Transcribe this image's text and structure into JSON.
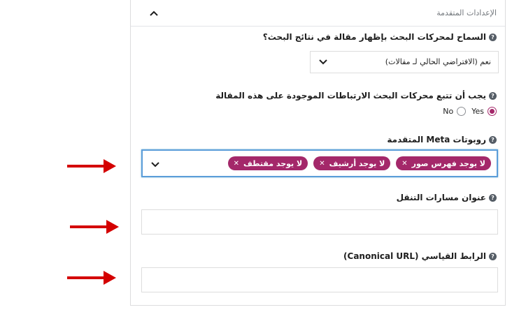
{
  "section": {
    "title": "الإعدادات المتقدمة"
  },
  "allow_search": {
    "label": "السماح لمحركات البحث بإظهار مقالة في نتائج البحث؟",
    "selected": "نعم (الافتراضي الحالي لـ مقالات)"
  },
  "follow_links": {
    "label": "يجب أن تتبع محركات البحث الارتباطات الموجودة على هذه المقالة",
    "yes_label": "Yes",
    "no_label": "No",
    "value": "Yes"
  },
  "meta_robots": {
    "label": "روبوتات Meta المتقدمة",
    "tags": [
      "لا يوجد فهرس صور",
      "لا يوجد أرشيف",
      "لا يوجد مقتطف"
    ]
  },
  "breadcrumbs": {
    "label": "عنوان مسارات التنقل",
    "value": ""
  },
  "canonical": {
    "label": "الرابط القياسي (Canonical URL)",
    "value": ""
  },
  "colors": {
    "accent": "#a4286a",
    "arrow": "#d40000",
    "focus": "#5b9dd9"
  }
}
